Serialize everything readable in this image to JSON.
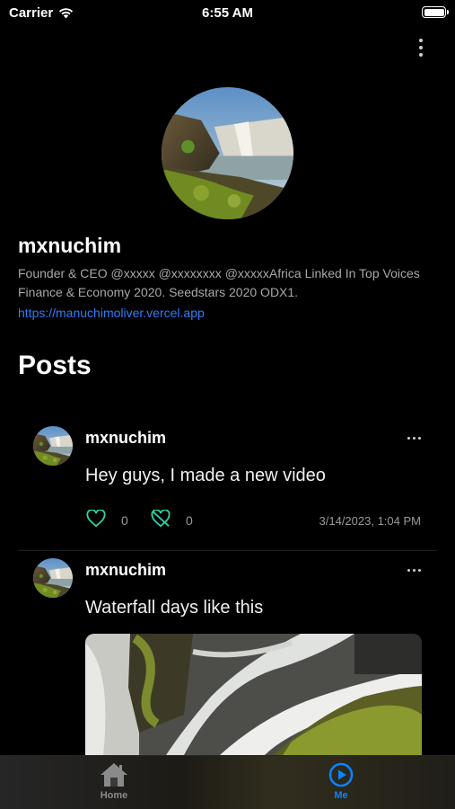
{
  "status_bar": {
    "carrier": "Carrier",
    "time": "6:55 AM"
  },
  "profile": {
    "name": "mxnuchim",
    "bio": "Founder & CEO  @xxxxx   @xxxxxxxx   @xxxxxAfrica  Linked In Top Voices Finance & Economy 2020. Seedstars 2020 ODX1.",
    "website": "https://manuchimoliver.vercel.app"
  },
  "posts_heading": "Posts",
  "posts": [
    {
      "author": "mxnuchim",
      "text": "Hey guys, I made a new video",
      "likes": "0",
      "dislikes": "0",
      "timestamp": "3/14/2023, 1:04 PM"
    },
    {
      "author": "mxnuchim",
      "text": "Waterfall days like this"
    }
  ],
  "tabs": [
    {
      "label": "Home",
      "icon": "home-icon"
    },
    {
      "label": "Me",
      "icon": "play-circle-icon",
      "active": true
    }
  ],
  "colors": {
    "accent": "#0a84ff",
    "link": "#2f7ef5",
    "like": "#2fd3a5"
  }
}
